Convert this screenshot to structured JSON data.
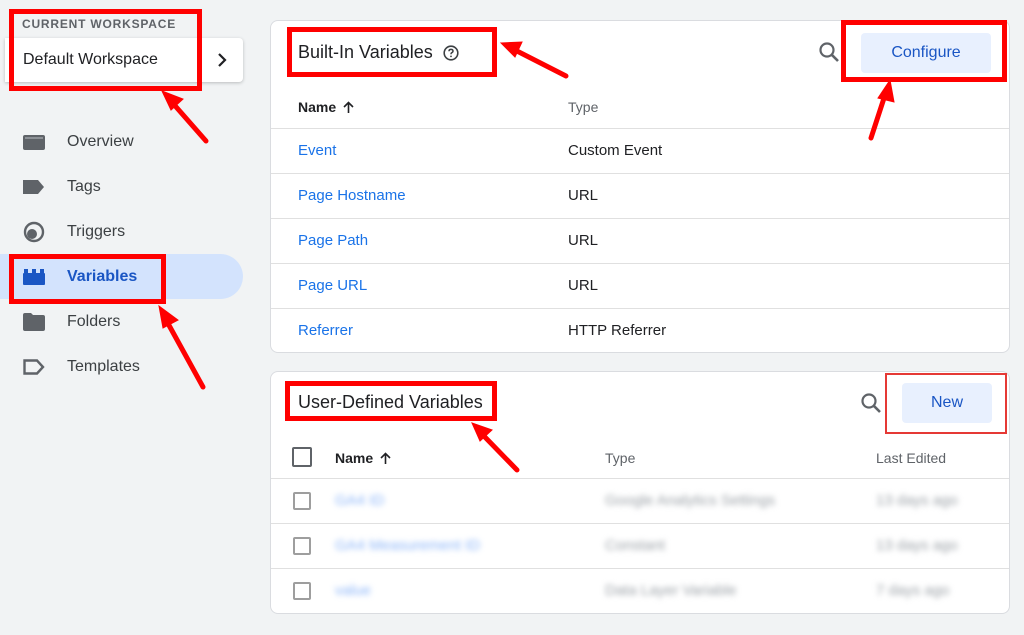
{
  "sidebar": {
    "workspace_label": "CURRENT WORKSPACE",
    "workspace_name": "Default Workspace",
    "items": [
      {
        "label": "Overview",
        "icon": "overview-icon"
      },
      {
        "label": "Tags",
        "icon": "tag-icon"
      },
      {
        "label": "Triggers",
        "icon": "trigger-icon"
      },
      {
        "label": "Variables",
        "icon": "variables-icon",
        "active": true
      },
      {
        "label": "Folders",
        "icon": "folder-icon"
      },
      {
        "label": "Templates",
        "icon": "template-icon"
      }
    ]
  },
  "builtin": {
    "title": "Built-In Variables",
    "configure_label": "Configure",
    "columns": {
      "name": "Name",
      "type": "Type"
    },
    "rows": [
      {
        "name": "Event",
        "type": "Custom Event"
      },
      {
        "name": "Page Hostname",
        "type": "URL"
      },
      {
        "name": "Page Path",
        "type": "URL"
      },
      {
        "name": "Page URL",
        "type": "URL"
      },
      {
        "name": "Referrer",
        "type": "HTTP Referrer"
      }
    ]
  },
  "user_defined": {
    "title": "User-Defined Variables",
    "new_label": "New",
    "columns": {
      "name": "Name",
      "type": "Type",
      "last_edited": "Last Edited"
    },
    "rows": [
      {
        "name": "GA4 ID",
        "type": "Google Analytics Settings",
        "last_edited": "13 days ago"
      },
      {
        "name": "GA4 Measurement ID",
        "type": "Constant",
        "last_edited": "13 days ago"
      },
      {
        "name": "value",
        "type": "Data Layer Variable",
        "last_edited": "7 days ago"
      }
    ]
  },
  "colors": {
    "accent": "#1a73e8",
    "active_nav_bg": "#d3e3fd",
    "annotation": "#ff0000"
  }
}
